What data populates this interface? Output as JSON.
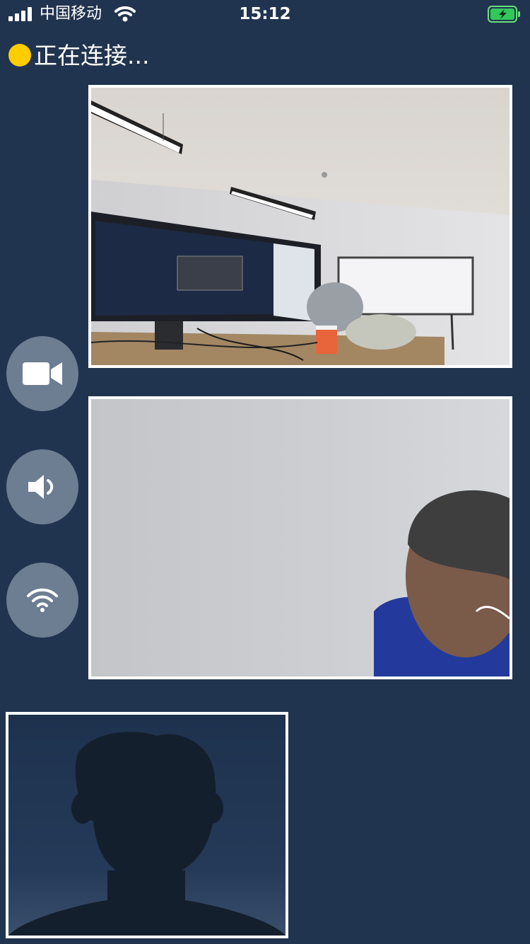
{
  "status_bar": {
    "carrier": "中国移动",
    "time": "15:12",
    "icons": [
      "signal-bars-icon",
      "wifi-icon",
      "battery-charging-icon"
    ]
  },
  "connection": {
    "status_text": "正在连接...",
    "status_color": "#ffcd00"
  },
  "video_tiles": [
    {
      "scene": "office-room-camera-feed"
    },
    {
      "scene": "person-near-wall-camera-feed"
    },
    {
      "scene": "placeholder-avatar"
    }
  ],
  "controls": [
    {
      "icon": "video-camera-icon"
    },
    {
      "icon": "speaker-icon"
    },
    {
      "icon": "wifi-icon"
    }
  ],
  "colors": {
    "background": "#21344f",
    "button": "#6d7d92",
    "tile_border": "#ffffff",
    "status_dot": "#ffcd00",
    "battery": "#33c85a"
  }
}
